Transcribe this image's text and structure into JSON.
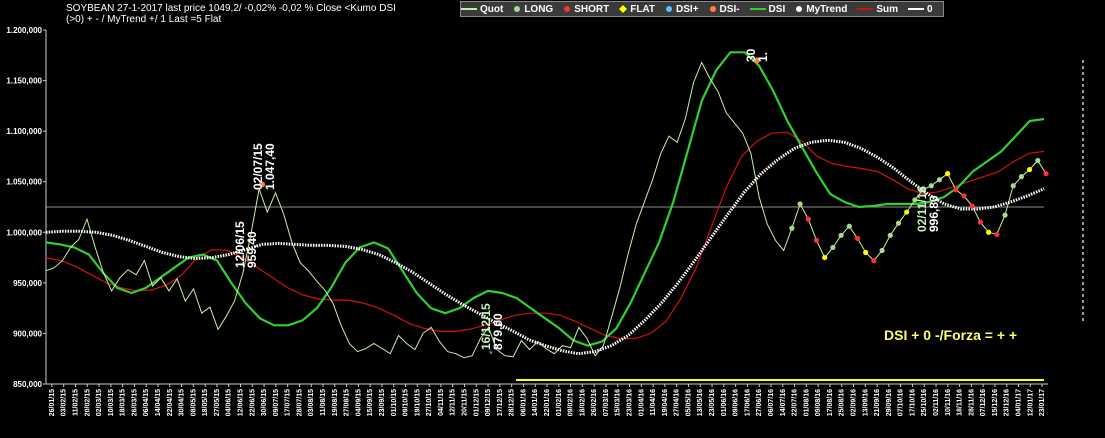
{
  "header": {
    "line1": "SOYBEAN  27-1-2017     last price 1049,2/  -0,02%  -0,02 %  Close <Kumo  DSI",
    "line2": "(>0) + - / MyTrend +/ 1 Last =5 Flat"
  },
  "legend": [
    {
      "label": "Quot",
      "color": "#c8f0a0",
      "kind": "line"
    },
    {
      "label": "LONG",
      "color": "#a8d890",
      "kind": "dot"
    },
    {
      "label": "SHORT",
      "color": "#ff3030",
      "kind": "dot"
    },
    {
      "label": "FLAT",
      "color": "#ffff00",
      "kind": "diamond"
    },
    {
      "label": "DSI+",
      "color": "#60c0ff",
      "kind": "star"
    },
    {
      "label": "DSI-",
      "color": "#ff8040",
      "kind": "dot"
    },
    {
      "label": "DSI",
      "color": "#30d030",
      "kind": "line"
    },
    {
      "label": "MyTrend",
      "color": "#ffffff",
      "kind": "dot"
    },
    {
      "label": "Sum",
      "color": "#d01010",
      "kind": "line"
    },
    {
      "label": "0",
      "color": "#ffffff",
      "kind": "line"
    }
  ],
  "dsi_label": "DSI  + 0 -/Forza = + +",
  "chart_data": {
    "type": "line",
    "ylim": [
      850000,
      1200000
    ],
    "y_ticks": [
      "850,000",
      "900,000",
      "950,000",
      "1.000,000",
      "1.050,000",
      "1.100,000",
      "1.150,000",
      "1.200,000"
    ],
    "y_tick_values": [
      850000,
      900000,
      950000,
      1000000,
      1050000,
      1100000,
      1150000,
      1200000
    ],
    "x_labels": [
      "26/01/15",
      "03/02/15",
      "11/02/15",
      "20/02/15",
      "02/03/15",
      "10/03/15",
      "18/03/15",
      "26/03/15",
      "06/04/15",
      "14/04/15",
      "22/04/15",
      "30/04/15",
      "08/05/15",
      "18/05/15",
      "27/05/15",
      "04/06/15",
      "12/06/15",
      "22/06/15",
      "30/06/15",
      "09/07/15",
      "17/07/15",
      "28/07/15",
      "03/08/15",
      "11/08/15",
      "19/08/15",
      "27/08/15",
      "04/09/15",
      "15/09/15",
      "23/09/15",
      "01/10/15",
      "09/10/15",
      "19/10/15",
      "27/10/15",
      "04/11/15",
      "12/11/15",
      "20/11/15",
      "01/12/15",
      "09/12/15",
      "17/12/15",
      "28/12/15",
      "06/01/16",
      "14/01/16",
      "22/01/16",
      "01/02/16",
      "09/02/16",
      "18/02/16",
      "26/02/16",
      "07/03/16",
      "15/03/16",
      "23/03/16",
      "01/04/16",
      "11/04/16",
      "19/04/16",
      "27/04/16",
      "05/05/16",
      "13/05/16",
      "23/05/16",
      "01/06/16",
      "09/06/16",
      "17/06/16",
      "27/06/16",
      "06/07/16",
      "14/07/16",
      "22/07/16",
      "01/08/16",
      "09/08/16",
      "17/08/16",
      "25/08/16",
      "02/09/16",
      "13/09/16",
      "21/09/16",
      "29/09/16",
      "07/10/16",
      "17/10/16",
      "25/10/16",
      "02/11/16",
      "10/11/16",
      "18/11/16",
      "28/11/16",
      "07/12/16",
      "15/12/16",
      "23/12/16",
      "04/01/17",
      "12/01/17",
      "23/01/17"
    ],
    "reference_level": 1025000,
    "series": [
      {
        "name": "Quot",
        "color": "#c8f0a0",
        "values": [
          962000,
          965000,
          972000,
          985000,
          993000,
          1013000,
          985000,
          960000,
          942000,
          955000,
          963000,
          958000,
          972000,
          947000,
          955000,
          942000,
          954000,
          932000,
          944000,
          920000,
          926000,
          904000,
          917000,
          932000,
          959000,
          998000,
          1043000,
          1020000,
          1039000,
          1018000,
          990000,
          970000,
          962000,
          952000,
          943000,
          930000,
          908000,
          890000,
          882000,
          885000,
          890000,
          885000,
          880000,
          898000,
          890000,
          884000,
          900000,
          906000,
          892000,
          882000,
          880000,
          876000,
          878000,
          895000,
          906000,
          884000,
          878000,
          877000,
          893000,
          884000,
          892000,
          885000,
          880000,
          888000,
          886000,
          906000,
          895000,
          878000,
          888000,
          916000,
          945000,
          978000,
          1008000,
          1030000,
          1052000,
          1078000,
          1095000,
          1089000,
          1112000,
          1148000,
          1168000,
          1152000,
          1139000,
          1118000,
          1108000,
          1098000,
          1078000,
          1035000,
          1008000,
          992000,
          982000,
          1004000,
          1028000,
          1013000,
          992000,
          975000,
          985000,
          997000,
          1006000,
          994000,
          980000,
          972000,
          982000,
          997000,
          1009000,
          1020000,
          1032000,
          1042000,
          1046000,
          1052000,
          1058000,
          1042000,
          1036000,
          1026000,
          1010000,
          1000000,
          998000,
          1017000,
          1046000,
          1055000,
          1062000,
          1071000,
          1058000
        ]
      },
      {
        "name": "DSI",
        "color": "#30d030",
        "values": [
          990000,
          988000,
          985000,
          978000,
          960000,
          945000,
          940000,
          945000,
          955000,
          965000,
          975000,
          978000,
          972000,
          950000,
          930000,
          915000,
          908000,
          908000,
          913000,
          925000,
          945000,
          970000,
          985000,
          990000,
          984000,
          962000,
          940000,
          925000,
          920000,
          925000,
          935000,
          942000,
          940000,
          935000,
          925000,
          915000,
          905000,
          893000,
          888000,
          892000,
          905000,
          930000,
          960000,
          990000,
          1030000,
          1080000,
          1130000,
          1160000,
          1178000,
          1178000,
          1165000,
          1140000,
          1110000,
          1085000,
          1060000,
          1038000,
          1030000,
          1025000,
          1026000,
          1028000,
          1028000,
          1028000,
          1030000,
          1035000,
          1045000,
          1060000,
          1070000,
          1080000,
          1095000,
          1110000,
          1112000
        ]
      },
      {
        "name": "Sum",
        "color": "#d01010",
        "values": [
          975000,
          972000,
          966000,
          958000,
          950000,
          945000,
          942000,
          943000,
          948000,
          958000,
          975000,
          983000,
          982000,
          975000,
          965000,
          955000,
          945000,
          938000,
          934000,
          933000,
          933000,
          930000,
          925000,
          918000,
          910000,
          905000,
          902000,
          902000,
          904000,
          908000,
          913000,
          918000,
          920000,
          920000,
          918000,
          912000,
          905000,
          898000,
          895000,
          895000,
          900000,
          912000,
          935000,
          965000,
          1005000,
          1045000,
          1075000,
          1090000,
          1098000,
          1099000,
          1090000,
          1075000,
          1068000,
          1065000,
          1063000,
          1060000,
          1052000,
          1043000,
          1038000,
          1040000,
          1045000,
          1050000,
          1055000,
          1060000,
          1070000,
          1078000,
          1080000
        ]
      },
      {
        "name": "MyTrend",
        "color": "#ffffff",
        "values": [
          1000000,
          1001000,
          1001000,
          1000000,
          997000,
          992000,
          986000,
          980000,
          976000,
          974000,
          975000,
          978000,
          983000,
          988000,
          989000,
          988000,
          987000,
          987000,
          986000,
          983000,
          978000,
          970000,
          961000,
          950000,
          939000,
          929000,
          920000,
          911000,
          903000,
          894000,
          888000,
          883000,
          880000,
          882000,
          888000,
          898000,
          913000,
          930000,
          950000,
          972000,
          995000,
          1018000,
          1040000,
          1058000,
          1072000,
          1083000,
          1089000,
          1091000,
          1089000,
          1083000,
          1074000,
          1063000,
          1050000,
          1038000,
          1028000,
          1023000,
          1023000,
          1025000,
          1030000,
          1036000,
          1043000
        ]
      }
    ],
    "annotations": [
      {
        "text": "02/07/15",
        "color": "#ffffff"
      },
      {
        "text": "1.047,40",
        "color": "#ffffff"
      },
      {
        "text": "12/06/15",
        "color": "#ffffff"
      },
      {
        "text": "959,40",
        "color": "#ffffff"
      },
      {
        "text": "16/12/15",
        "color": "#c8f0c0"
      },
      {
        "text": "879,00",
        "color": "#ffffff"
      },
      {
        "text": "30",
        "color": "#ffffff"
      },
      {
        "text": "1.",
        "color": "#ffffff"
      },
      {
        "text": "02/11/16",
        "color": "#c8f0c0"
      },
      {
        "text": "996,80",
        "color": "#ffffff"
      }
    ]
  }
}
